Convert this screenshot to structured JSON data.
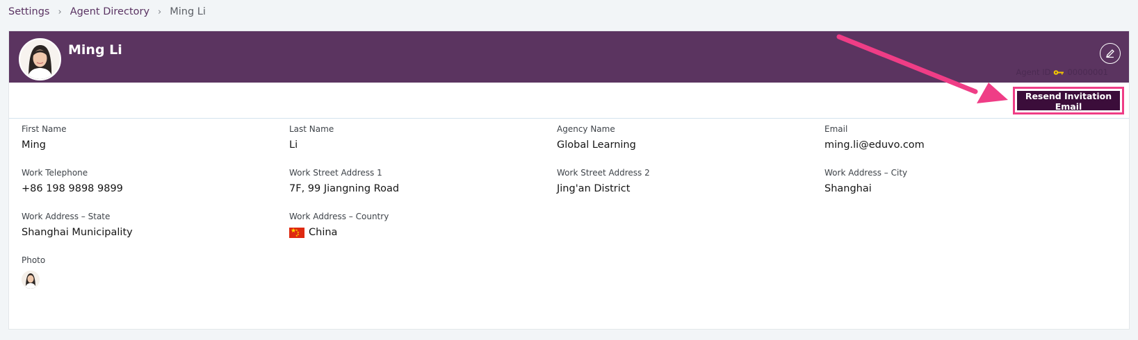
{
  "breadcrumb": {
    "items": [
      "Settings",
      "Agent Directory"
    ],
    "current": "Ming Li"
  },
  "agent": {
    "name": "Ming Li",
    "id_label": "Agent ID",
    "id_value": "00000001"
  },
  "actions": {
    "resend_label": "Resend Invitation Email"
  },
  "fields": {
    "first_name": {
      "label": "First Name",
      "value": "Ming"
    },
    "last_name": {
      "label": "Last Name",
      "value": "Li"
    },
    "agency_name": {
      "label": "Agency Name",
      "value": "Global Learning"
    },
    "email": {
      "label": "Email",
      "value": "ming.li@eduvo.com"
    },
    "work_telephone": {
      "label": "Work Telephone",
      "value": "+86 198 9898 9899"
    },
    "work_street_1": {
      "label": "Work Street Address 1",
      "value": "7F, 99 Jiangning Road"
    },
    "work_street_2": {
      "label": "Work Street Address 2",
      "value": "Jing'an District"
    },
    "work_city": {
      "label": "Work Address – City",
      "value": "Shanghai"
    },
    "work_state": {
      "label": "Work Address – State",
      "value": "Shanghai Municipality"
    },
    "work_country": {
      "label": "Work Address – Country",
      "value": "China"
    },
    "photo": {
      "label": "Photo"
    }
  },
  "icons": {
    "edit": "pencil-icon",
    "key": "key-icon",
    "flag": "china-flag-icon",
    "annotation": "arrow-annotation"
  },
  "colors": {
    "header_bg": "#5b3460",
    "button_bg": "#3b0d3a",
    "highlight": "#ef3d86",
    "link": "#5a3362"
  }
}
